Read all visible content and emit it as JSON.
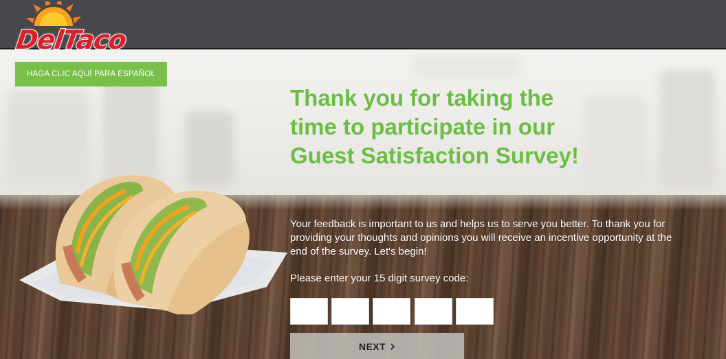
{
  "brand": {
    "logo_text": "DelTaco",
    "colors": {
      "green": "#6cbd45",
      "button_green": "#79c04a",
      "logo_red": "#d8202a",
      "header": "#48474b"
    }
  },
  "language_toggle": {
    "label": "HAGA CLIC AQUÍ PARA ESPAÑOL"
  },
  "hero": {
    "headline_lines": [
      "Thank you for taking the",
      "time to participate in our",
      "Guest Satisfaction Survey!"
    ]
  },
  "survey": {
    "intro": "Your feedback is important to us and helps us to serve you better. To thank you for providing your thoughts and opinions you will receive an incentive opportunity at the end of the survey. Let's begin!",
    "code_prompt": "Please enter your 15 digit survey code:",
    "code_fields": [
      "",
      "",
      "",
      "",
      ""
    ],
    "next_label": "NEXT",
    "next_icon": "chevron-right-icon"
  }
}
